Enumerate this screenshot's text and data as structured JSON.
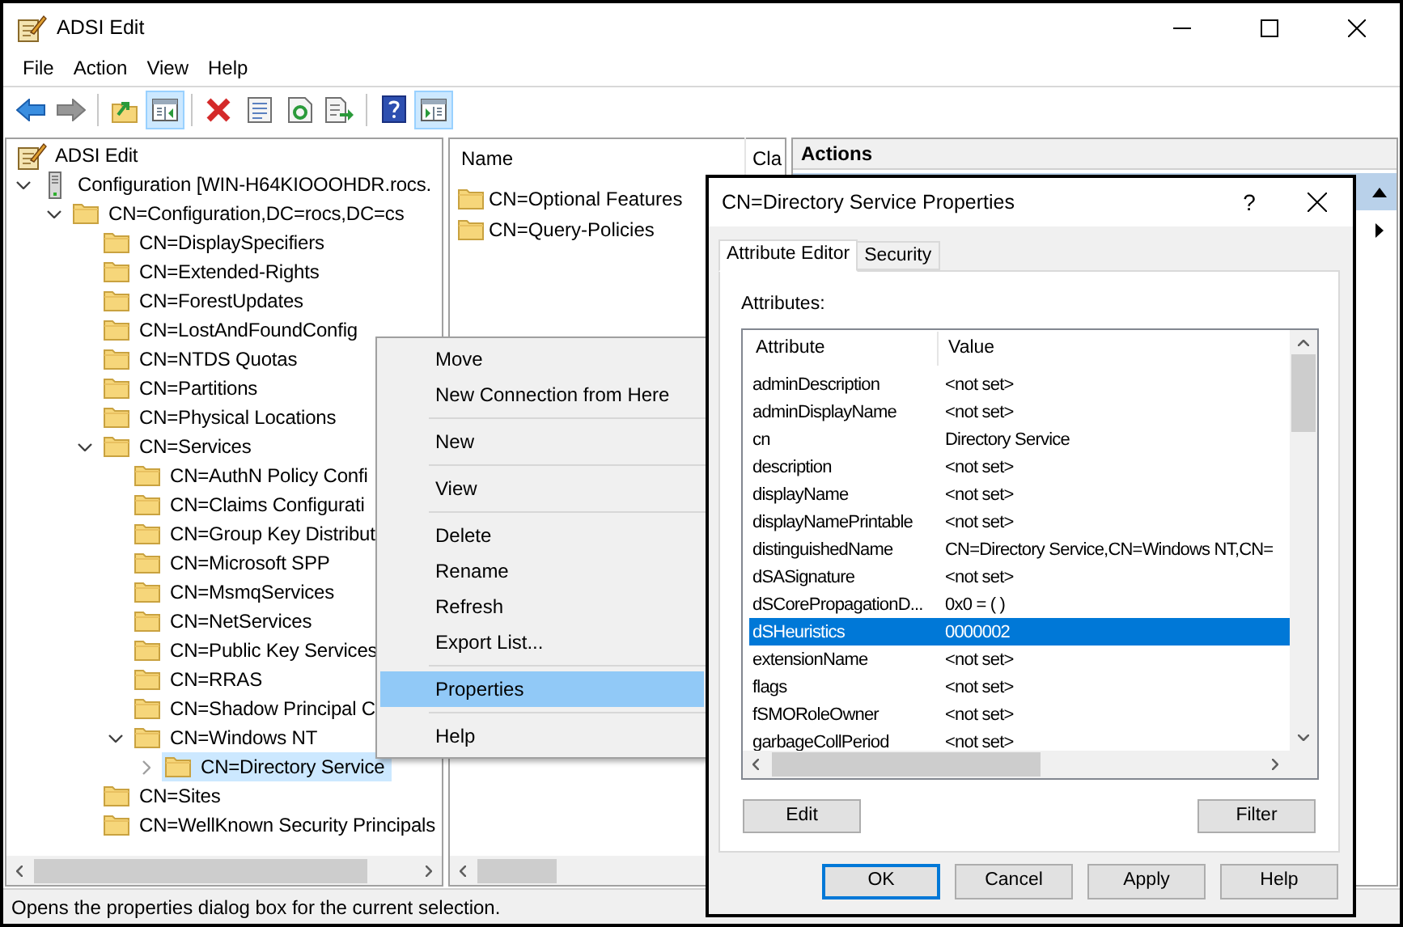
{
  "window": {
    "title": "ADSI Edit"
  },
  "menu_bar": [
    "File",
    "Action",
    "View",
    "Help"
  ],
  "toolbar": [
    {
      "kind": "back",
      "pressed": false,
      "disabled": false
    },
    {
      "kind": "forward",
      "pressed": false,
      "disabled": true
    },
    {
      "kind": "separator"
    },
    {
      "kind": "up",
      "pressed": false,
      "disabled": false
    },
    {
      "kind": "console_tree",
      "pressed": true,
      "disabled": false
    },
    {
      "kind": "separator"
    },
    {
      "kind": "delete",
      "pressed": false,
      "disabled": false
    },
    {
      "kind": "properties",
      "pressed": false,
      "disabled": false
    },
    {
      "kind": "refresh",
      "pressed": false,
      "disabled": false
    },
    {
      "kind": "export",
      "pressed": false,
      "disabled": false
    },
    {
      "kind": "separator"
    },
    {
      "kind": "help",
      "pressed": false,
      "disabled": false
    },
    {
      "kind": "action_pane",
      "pressed": true,
      "disabled": false
    }
  ],
  "tree": [
    {
      "kind": "snapin",
      "label": "ADSI Edit",
      "selected": false,
      "children": [
        {
          "kind": "server",
          "label": "Configuration [WIN-H64KIOOOHDR.rocs.",
          "expanded": true,
          "selected": false,
          "children": [
            {
              "kind": "folder",
              "label": "CN=Configuration,DC=rocs,DC=cs",
              "expanded": true,
              "selected": false,
              "children": [
                {
                  "kind": "folder",
                  "label": "CN=DisplaySpecifiers",
                  "selected": false
                },
                {
                  "kind": "folder",
                  "label": "CN=Extended-Rights",
                  "selected": false
                },
                {
                  "kind": "folder",
                  "label": "CN=ForestUpdates",
                  "selected": false
                },
                {
                  "kind": "folder",
                  "label": "CN=LostAndFoundConfig",
                  "selected": false
                },
                {
                  "kind": "folder",
                  "label": "CN=NTDS Quotas",
                  "selected": false
                },
                {
                  "kind": "folder",
                  "label": "CN=Partitions",
                  "selected": false
                },
                {
                  "kind": "folder",
                  "label": "CN=Physical Locations",
                  "selected": false
                },
                {
                  "kind": "folder",
                  "label": "CN=Services",
                  "expanded": true,
                  "selected": false,
                  "children": [
                    {
                      "kind": "folder",
                      "label": "CN=AuthN Policy Confi",
                      "selected": false
                    },
                    {
                      "kind": "folder",
                      "label": "CN=Claims Configurati",
                      "selected": false
                    },
                    {
                      "kind": "folder",
                      "label": "CN=Group Key Distribut",
                      "selected": false
                    },
                    {
                      "kind": "folder",
                      "label": "CN=Microsoft SPP",
                      "selected": false
                    },
                    {
                      "kind": "folder",
                      "label": "CN=MsmqServices",
                      "selected": false
                    },
                    {
                      "kind": "folder",
                      "label": "CN=NetServices",
                      "selected": false
                    },
                    {
                      "kind": "folder",
                      "label": "CN=Public Key Services",
                      "selected": false
                    },
                    {
                      "kind": "folder",
                      "label": "CN=RRAS",
                      "selected": false
                    },
                    {
                      "kind": "folder",
                      "label": "CN=Shadow Principal C",
                      "selected": false
                    },
                    {
                      "kind": "folder",
                      "label": "CN=Windows NT",
                      "expanded": true,
                      "selected": false,
                      "children": [
                        {
                          "kind": "folder",
                          "label": "CN=Directory Service",
                          "expanded": false,
                          "selected": true
                        }
                      ]
                    }
                  ]
                },
                {
                  "kind": "folder",
                  "label": "CN=Sites",
                  "selected": false
                },
                {
                  "kind": "folder",
                  "label": "CN=WellKnown Security Principals",
                  "selected": false
                }
              ]
            }
          ]
        }
      ]
    }
  ],
  "list_pane": {
    "columns": [
      "Name",
      "Cla"
    ],
    "items": [
      {
        "label": "CN=Optional Features",
        "selected": false
      },
      {
        "label": "CN=Query-Policies",
        "selected": false
      }
    ]
  },
  "actions_pane": {
    "title": "Actions"
  },
  "context_menu": [
    {
      "kind": "item",
      "label": "Move",
      "selected": false
    },
    {
      "kind": "item",
      "label": "New Connection from Here",
      "selected": false
    },
    {
      "kind": "separator"
    },
    {
      "kind": "item",
      "label": "New",
      "selected": false
    },
    {
      "kind": "separator"
    },
    {
      "kind": "item",
      "label": "View",
      "selected": false
    },
    {
      "kind": "separator"
    },
    {
      "kind": "item",
      "label": "Delete",
      "selected": false
    },
    {
      "kind": "item",
      "label": "Rename",
      "selected": false
    },
    {
      "kind": "item",
      "label": "Refresh",
      "selected": false
    },
    {
      "kind": "item",
      "label": "Export List...",
      "selected": false
    },
    {
      "kind": "separator"
    },
    {
      "kind": "item",
      "label": "Properties",
      "selected": true
    },
    {
      "kind": "separator"
    },
    {
      "kind": "item",
      "label": "Help",
      "selected": false
    }
  ],
  "dialog": {
    "title": "CN=Directory Service Properties",
    "help_glyph": "?",
    "tabs": [
      {
        "label": "Attribute Editor",
        "selected": true
      },
      {
        "label": "Security",
        "selected": false
      }
    ],
    "list_label": "Attributes:",
    "columns": [
      "Attribute",
      "Value"
    ],
    "rows": [
      {
        "attribute": "adminDescription",
        "value": "<not set>",
        "selected": false
      },
      {
        "attribute": "adminDisplayName",
        "value": "<not set>",
        "selected": false
      },
      {
        "attribute": "cn",
        "value": "Directory Service",
        "selected": false
      },
      {
        "attribute": "description",
        "value": "<not set>",
        "selected": false
      },
      {
        "attribute": "displayName",
        "value": "<not set>",
        "selected": false
      },
      {
        "attribute": "displayNamePrintable",
        "value": "<not set>",
        "selected": false
      },
      {
        "attribute": "distinguishedName",
        "value": "CN=Directory Service,CN=Windows NT,CN=",
        "selected": false
      },
      {
        "attribute": "dSASignature",
        "value": "<not set>",
        "selected": false
      },
      {
        "attribute": "dSCorePropagationD...",
        "value": "0x0 = ( )",
        "selected": false
      },
      {
        "attribute": "dSHeuristics",
        "value": "0000002",
        "selected": true
      },
      {
        "attribute": "extensionName",
        "value": "<not set>",
        "selected": false
      },
      {
        "attribute": "flags",
        "value": "<not set>",
        "selected": false
      },
      {
        "attribute": "fSMORoleOwner",
        "value": "<not set>",
        "selected": false
      },
      {
        "attribute": "garbageCollPeriod",
        "value": "<not set>",
        "selected": false
      }
    ],
    "list_buttons": [
      "Edit",
      "Filter"
    ],
    "footer_buttons": [
      {
        "label": "OK",
        "default": true
      },
      {
        "label": "Cancel",
        "default": false
      },
      {
        "label": "Apply",
        "default": false
      },
      {
        "label": "Help",
        "default": false
      }
    ]
  },
  "status_bar": "Opens the properties dialog box for the current selection."
}
